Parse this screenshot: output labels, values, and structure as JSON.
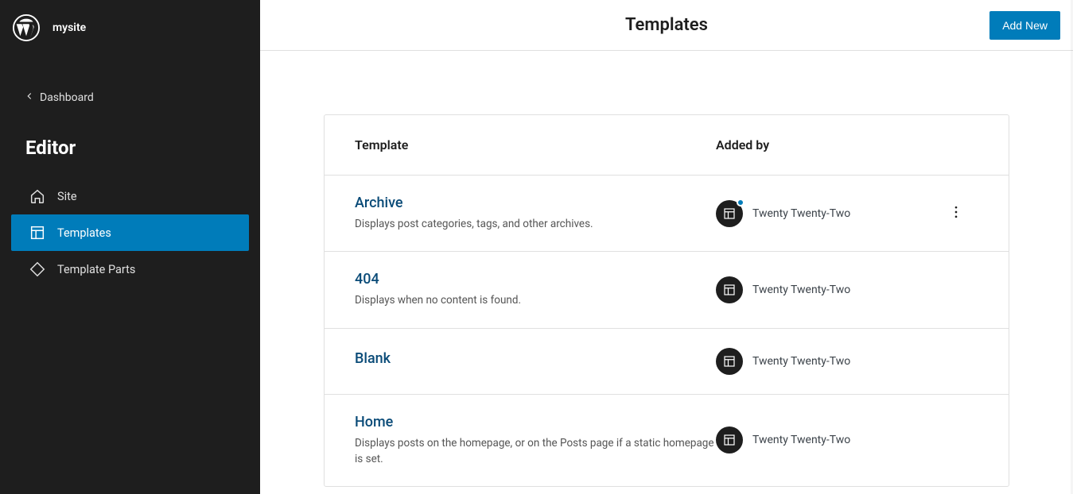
{
  "site_name": "mysite",
  "back_link": "Dashboard",
  "section_title": "Editor",
  "nav": [
    {
      "label": "Site",
      "icon": "home-icon",
      "active": false
    },
    {
      "label": "Templates",
      "icon": "layout-icon",
      "active": true
    },
    {
      "label": "Template Parts",
      "icon": "symbol-icon",
      "active": false
    }
  ],
  "page_title": "Templates",
  "add_new_label": "Add New",
  "table": {
    "header_template": "Template",
    "header_added_by": "Added by",
    "rows": [
      {
        "name": "Archive",
        "description": "Displays post categories, tags, and other archives.",
        "added_by": "Twenty Twenty-Two",
        "has_indicator": true,
        "has_actions": true
      },
      {
        "name": "404",
        "description": "Displays when no content is found.",
        "added_by": "Twenty Twenty-Two",
        "has_indicator": false,
        "has_actions": false
      },
      {
        "name": "Blank",
        "description": "",
        "added_by": "Twenty Twenty-Two",
        "has_indicator": false,
        "has_actions": false
      },
      {
        "name": "Home",
        "description": "Displays posts on the homepage, or on the Posts page if a static homepage is set.",
        "added_by": "Twenty Twenty-Two",
        "has_indicator": false,
        "has_actions": false
      }
    ]
  }
}
